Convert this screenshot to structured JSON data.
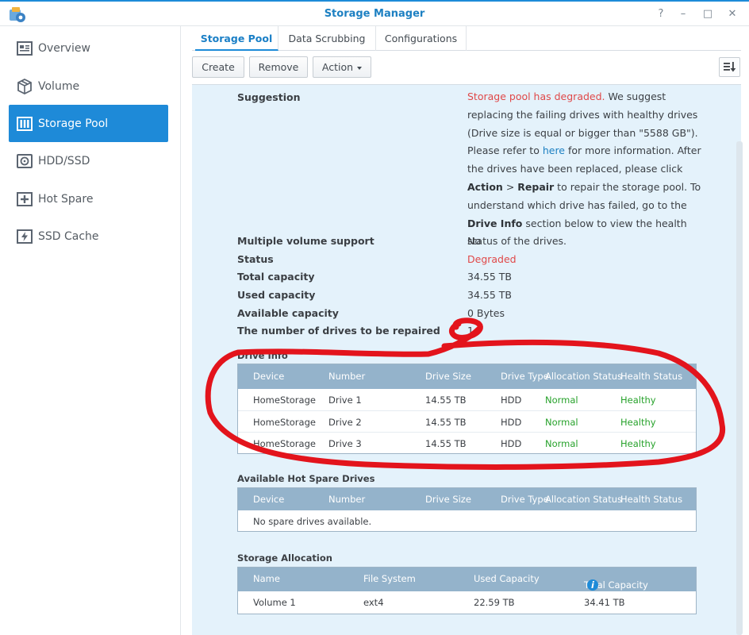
{
  "window": {
    "title": "Storage Manager",
    "buttons": [
      "?",
      "–",
      "□",
      "✕"
    ]
  },
  "sidebar": {
    "items": [
      {
        "label": "Overview",
        "icon": "overview-icon",
        "active": false
      },
      {
        "label": "Volume",
        "icon": "volume-icon",
        "active": false
      },
      {
        "label": "Storage Pool",
        "icon": "storage-pool-icon",
        "active": true
      },
      {
        "label": "HDD/SSD",
        "icon": "hdd-icon",
        "active": false
      },
      {
        "label": "Hot Spare",
        "icon": "hot-spare-icon",
        "active": false
      },
      {
        "label": "SSD Cache",
        "icon": "ssd-cache-icon",
        "active": false
      }
    ]
  },
  "tabs": [
    {
      "label": "Storage Pool",
      "active": true
    },
    {
      "label": "Data Scrubbing",
      "active": false
    },
    {
      "label": "Configurations",
      "active": false
    }
  ],
  "toolbar": {
    "create": "Create",
    "remove": "Remove",
    "action": "Action"
  },
  "details": {
    "suggestion_label": "Suggestion",
    "suggestion": {
      "alert": "Storage pool has degraded.",
      "p1": " We suggest replacing the failing drives with healthy drives (Drive size is equal or bigger than \"5588 GB\"). Please refer to ",
      "link": "here",
      "p2": " for more information. After the drives have been replaced, please click ",
      "action": "Action",
      "p3": " > ",
      "repair": "Repair",
      "p4": " to repair the storage pool. To understand which drive has failed, go to the ",
      "drive_info": "Drive Info",
      "p5": " section below to view the health status of the drives."
    },
    "multi_volume_label": "Multiple volume support",
    "multi_volume": "No",
    "status_label": "Status",
    "status": "Degraded",
    "total_label": "Total capacity",
    "total": "34.55 TB",
    "used_label": "Used capacity",
    "used": "34.55 TB",
    "available_label": "Available capacity",
    "available": "0 Bytes",
    "repair_count_label": "The number of drives to be repaired",
    "repair_count": "1"
  },
  "drive_info": {
    "title": "Drive Info",
    "columns": [
      "Device",
      "Number",
      "Drive Size",
      "Drive Type",
      "Allocation Status",
      "Health Status"
    ],
    "rows": [
      {
        "device": "HomeStorage",
        "number": "Drive 1",
        "size": "14.55 TB",
        "type": "HDD",
        "allocation": "Normal",
        "health": "Healthy"
      },
      {
        "device": "HomeStorage",
        "number": "Drive 2",
        "size": "14.55 TB",
        "type": "HDD",
        "allocation": "Normal",
        "health": "Healthy"
      },
      {
        "device": "HomeStorage",
        "number": "Drive 3",
        "size": "14.55 TB",
        "type": "HDD",
        "allocation": "Normal",
        "health": "Healthy"
      }
    ]
  },
  "hot_spare": {
    "title": "Available Hot Spare Drives",
    "columns": [
      "Device",
      "Number",
      "Drive Size",
      "Drive Type",
      "Allocation Status",
      "Health Status"
    ],
    "empty": "No spare drives available."
  },
  "storage_allocation": {
    "title": "Storage Allocation",
    "columns": [
      "Name",
      "File System",
      "Used Capacity",
      "Total Capacity"
    ],
    "rows": [
      {
        "name": "Volume 1",
        "fs": "ext4",
        "used": "22.59 TB",
        "total": "34.41 TB"
      }
    ]
  },
  "colors": {
    "accent": "#1d8bd8",
    "alert": "#e04848",
    "ok": "#27a22b",
    "panel_bg": "#e4f2fb",
    "annotation": "#e3141c"
  }
}
